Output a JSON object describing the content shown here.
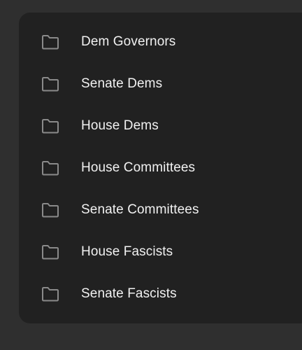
{
  "folder_list": {
    "items": [
      {
        "label": "Dem Governors",
        "icon": "folder-icon"
      },
      {
        "label": "Senate Dems",
        "icon": "folder-icon"
      },
      {
        "label": "House Dems",
        "icon": "folder-icon"
      },
      {
        "label": "House Committees",
        "icon": "folder-icon"
      },
      {
        "label": "Senate Committees",
        "icon": "folder-icon"
      },
      {
        "label": "House Fascists",
        "icon": "folder-icon"
      },
      {
        "label": "Senate Fascists",
        "icon": "folder-icon"
      }
    ]
  },
  "colors": {
    "background": "#2f2f2f",
    "panel": "#212121",
    "text": "#f1f1f1",
    "icon": "#8a8a8a"
  }
}
